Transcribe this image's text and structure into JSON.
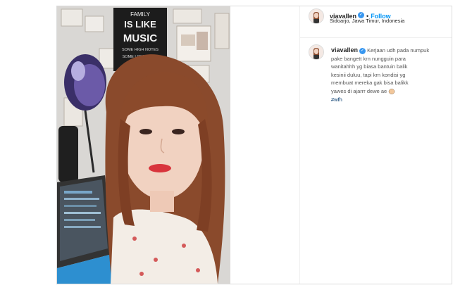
{
  "post": {
    "username": "viavallen",
    "follow_label": "Follow",
    "separator": "•",
    "location": "Sidoarjo, Jawa Timur, Indonesia",
    "caption_lines": [
      "Kerjaan udh pada numpuk",
      "pake bangett krn nungguin para",
      "wanitahhh yg biasa bantuin balik",
      "kesinii duluu, tapi krn kondisi yg",
      "membuat mereka gak bisa balikk",
      "yawes di ajarrr dewe ae"
    ],
    "hashtag": "#wfh"
  },
  "photo": {
    "poster_lines": [
      "FAMILY",
      "IS LIKE",
      "MUSIC",
      "SOME HIGH NOTES",
      "SOME LOW NOTES"
    ]
  },
  "icons": {
    "verified": "verified-badge-icon",
    "emoji": "clapping-hands-emoji"
  },
  "colors": {
    "follow": "#0095f6",
    "verified": "#3897f0",
    "hashtag": "#00376b",
    "border": "#dbdbdb"
  }
}
